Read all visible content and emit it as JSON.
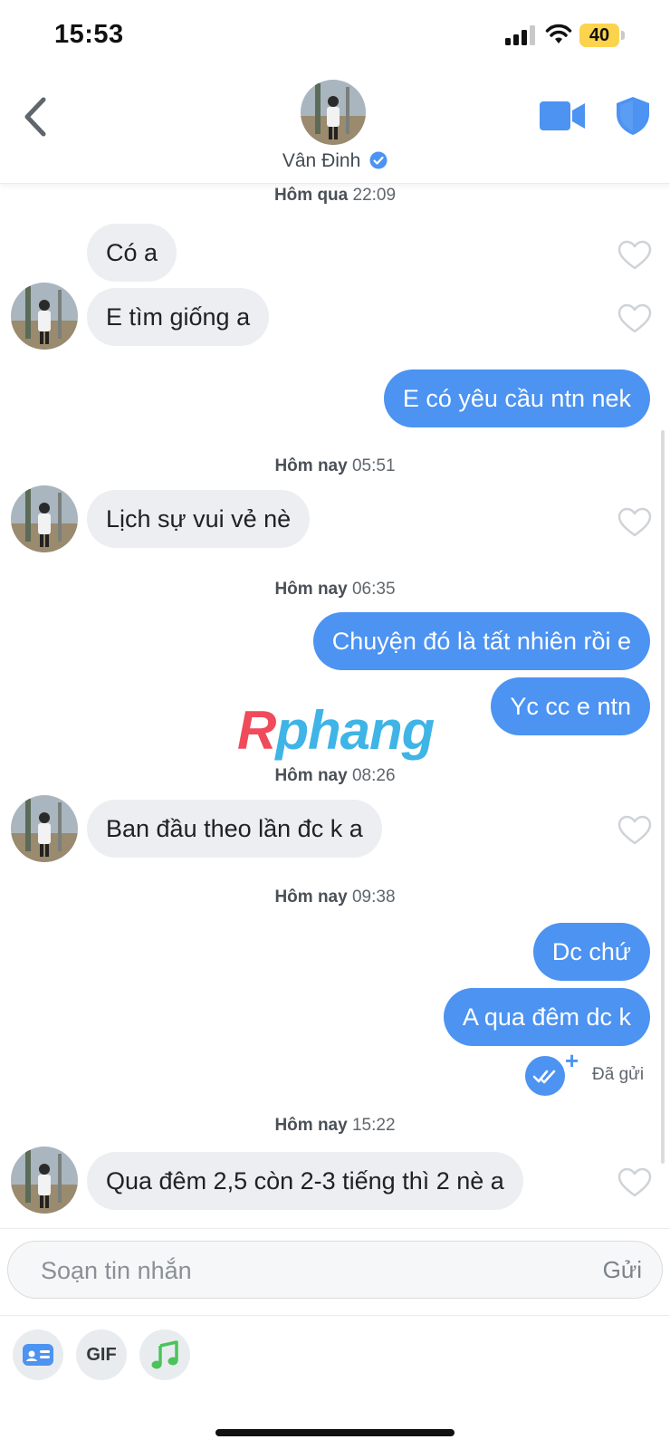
{
  "status_bar": {
    "time": "15:53",
    "battery": "40"
  },
  "header": {
    "contact_name": "Vân Đinh"
  },
  "messages": [
    {
      "timestamp_day": "Hôm qua",
      "timestamp_time": "22:09"
    },
    {
      "text": "Có a"
    },
    {
      "text": "E tìm giống a"
    },
    {
      "text": "E có yêu cầu ntn nek"
    },
    {
      "timestamp_day": "Hôm nay",
      "timestamp_time": "05:51"
    },
    {
      "text": "Lịch sự vui vẻ nè"
    },
    {
      "timestamp_day": "Hôm nay",
      "timestamp_time": "06:35"
    },
    {
      "text": "Chuyện đó là tất nhiên rồi e"
    },
    {
      "text": "Yc cc e ntn"
    },
    {
      "timestamp_day": "Hôm nay",
      "timestamp_time": "08:26"
    },
    {
      "text": "Ban đầu theo lần đc k a"
    },
    {
      "timestamp_day": "Hôm nay",
      "timestamp_time": "09:38"
    },
    {
      "text": "Dc chứ"
    },
    {
      "text": "A qua đêm dc k"
    },
    {
      "timestamp_day": "Hôm nay",
      "timestamp_time": "15:22"
    },
    {
      "text": "Qua đêm 2,5 còn 2-3 tiếng thì 2 nè a"
    }
  ],
  "sent_status": "Đã gửi",
  "watermark": {
    "part1": "R",
    "part2": "phang"
  },
  "composer": {
    "placeholder": "Soạn tin nhắn",
    "send_label": "Gửi"
  },
  "toolbar": {
    "gif_label": "GIF"
  },
  "icons": {
    "back": "chevron-left-icon",
    "video": "video-camera-icon",
    "shield": "shield-icon",
    "verified": "verified-badge-icon",
    "heart": "heart-outline-icon",
    "sent": "double-check-icon",
    "card": "id-card-icon",
    "music": "music-note-icon"
  },
  "colors": {
    "accent": "#4c93f2",
    "incoming_bubble": "#eceef1",
    "battery": "#fcd34d",
    "music": "#4cc35a"
  }
}
